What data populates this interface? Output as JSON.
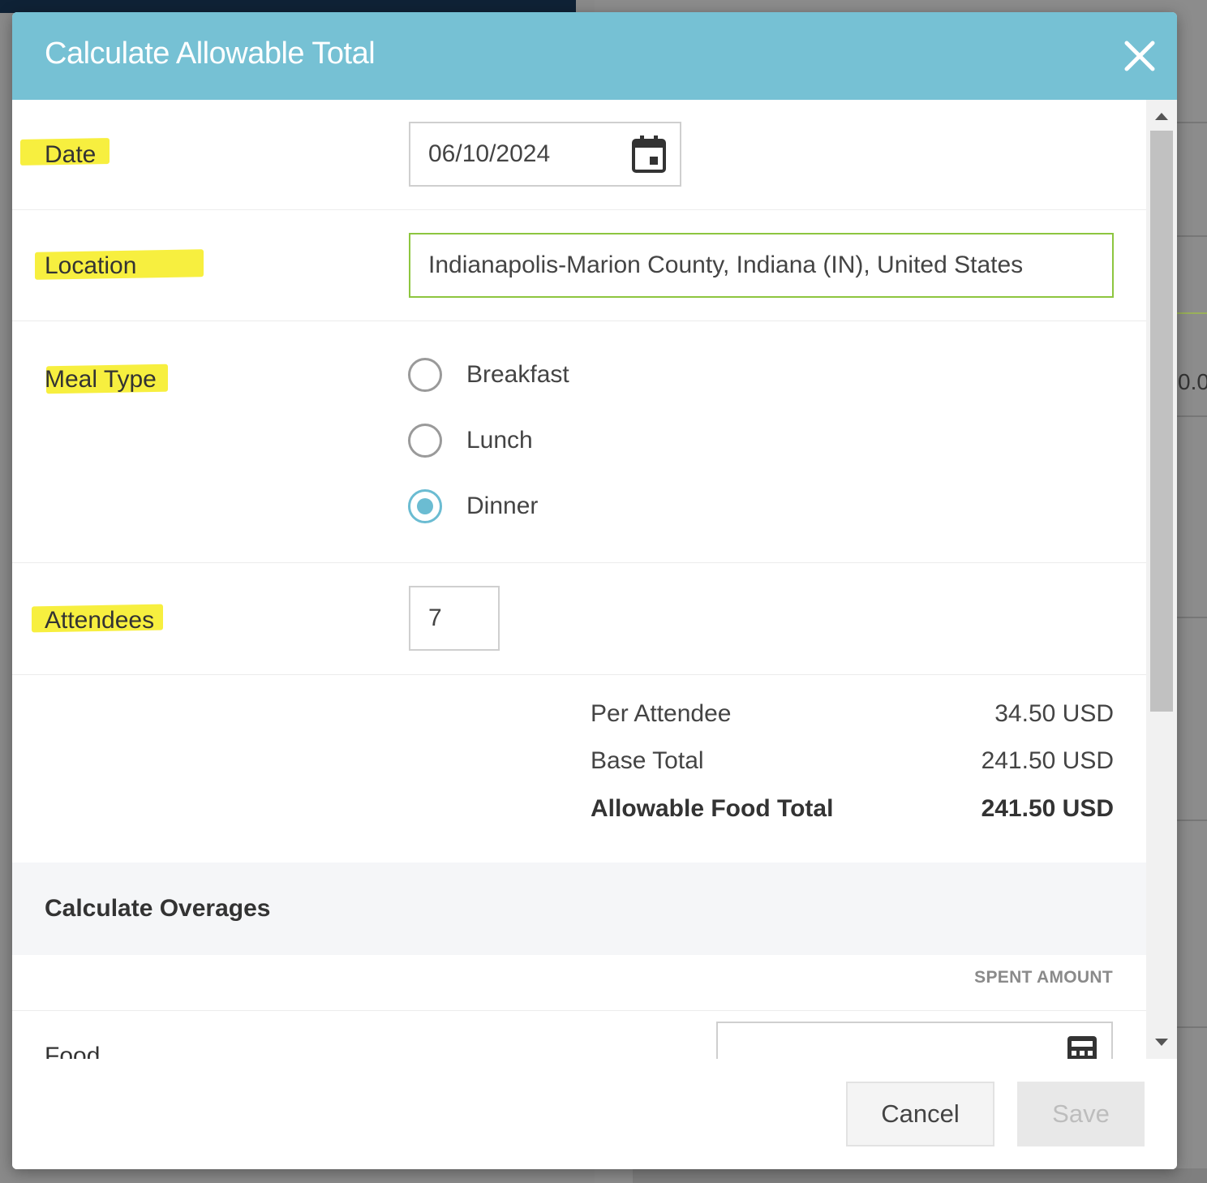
{
  "modal": {
    "title": "Calculate Allowable Total",
    "close_icon": "close-icon"
  },
  "form": {
    "date": {
      "label": "Date",
      "value": "06/10/2024",
      "icon": "calendar-icon"
    },
    "location": {
      "label": "Location",
      "value": "Indianapolis-Marion County, Indiana (IN), United States"
    },
    "meal_type": {
      "label": "Meal Type",
      "options": [
        {
          "label": "Breakfast",
          "selected": false
        },
        {
          "label": "Lunch",
          "selected": false
        },
        {
          "label": "Dinner",
          "selected": true
        }
      ]
    },
    "attendees": {
      "label": "Attendees",
      "value": "7"
    }
  },
  "summary": {
    "per_attendee": {
      "label": "Per Attendee",
      "value": "34.50 USD"
    },
    "base_total": {
      "label": "Base Total",
      "value": "241.50 USD"
    },
    "allowable_food_total": {
      "label": "Allowable Food Total",
      "value": "241.50 USD"
    }
  },
  "overages": {
    "title": "Calculate Overages",
    "column_header": "SPENT AMOUNT",
    "rows": [
      {
        "label": "Food",
        "value": "",
        "icon": "calculator-icon"
      }
    ]
  },
  "footer": {
    "cancel_label": "Cancel",
    "save_label": "Save"
  },
  "background": {
    "fragment_text": "0.0"
  },
  "colors": {
    "header": "#76c1d4",
    "highlight": "#f6ec1d",
    "valid_border": "#8dc63f",
    "radio_selected": "#6bbcd2"
  }
}
